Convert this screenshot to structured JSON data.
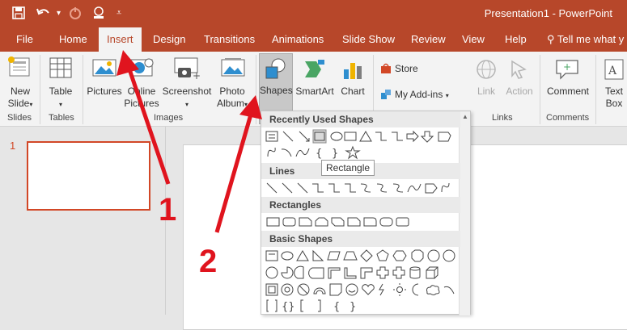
{
  "title_bar": {
    "doc_title": "Presentation1  -  PowerPoint",
    "qat_icons": [
      "save-icon",
      "undo-icon",
      "redo-icon",
      "touch-mode-icon",
      "customize-icon"
    ],
    "accent": "#b7472a"
  },
  "tabs": [
    "File",
    "Home",
    "Insert",
    "Design",
    "Transitions",
    "Animations",
    "Slide Show",
    "Review",
    "View",
    "Help"
  ],
  "active_tab": "Insert",
  "tell_me": "Tell me what y",
  "ribbon": {
    "new_slide_l1": "New",
    "new_slide_l2": "Slide",
    "table": "Table",
    "pictures": "Pictures",
    "online_pictures_l1": "Online",
    "online_pictures_l2": "Pictures",
    "screenshot": "Screenshot",
    "photo_album_l1": "Photo",
    "photo_album_l2": "Album",
    "shapes": "Shapes",
    "smartart": "SmartArt",
    "chart": "Chart",
    "store": "Store",
    "my_addins": "My Add-ins",
    "link": "Link",
    "action": "Action",
    "comment": "Comment",
    "text_box_l1": "Text",
    "text_box_l2": "Box",
    "groups": {
      "slides": "Slides",
      "tables": "Tables",
      "images": "Images",
      "links": "Links",
      "comments": "Comments"
    }
  },
  "thumbnail": {
    "slide_number": "1"
  },
  "shapes_menu": {
    "sections": [
      "Recently Used Shapes",
      "Lines",
      "Rectangles",
      "Basic Shapes"
    ],
    "tooltip": "Rectangle"
  },
  "annotations": {
    "label_1": "1",
    "label_2": "2",
    "color": "#e0141e"
  }
}
